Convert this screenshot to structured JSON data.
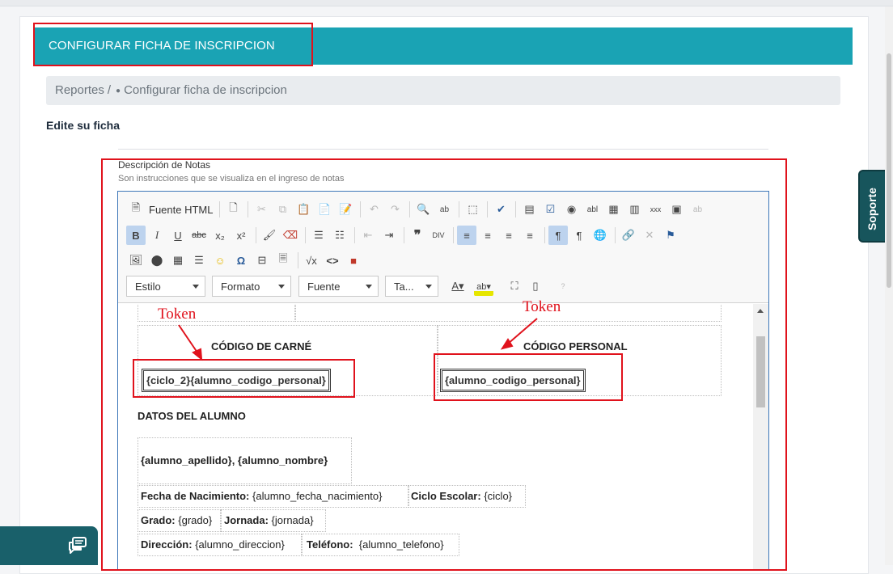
{
  "header": {
    "title": "CONFIGURAR FICHA DE INSCRIPCION"
  },
  "breadcrumb": {
    "root": "Reportes",
    "separator": "/",
    "current": "Configurar ficha de inscripcion"
  },
  "section_title": "Edite su ficha",
  "field": {
    "label": "Descripción de Notas",
    "help": "Son instrucciones que se visualiza en el ingreso de notas"
  },
  "toolbar": {
    "source_label": "Fuente HTML",
    "combos": [
      "Estilo",
      "Formato",
      "Fuente",
      "Ta..."
    ],
    "icons_row1": [
      "source-icon",
      "template-icon",
      "cut-icon",
      "copy-icon",
      "paste-icon",
      "paste-text-icon",
      "paste-word-icon",
      "undo-icon",
      "redo-icon",
      "find-icon",
      "replace-icon",
      "select-all-icon",
      "spellcheck-icon",
      "form-icon",
      "checkbox-icon",
      "radio-icon",
      "textfield-icon",
      "textarea-icon",
      "select-icon",
      "button-icon",
      "image-button-icon",
      "hidden-field-icon"
    ],
    "icons_row2": [
      "bold-icon",
      "italic-icon",
      "underline-icon",
      "strike-icon",
      "subscript-icon",
      "superscript-icon",
      "copy-format-icon",
      "remove-format-icon",
      "numbered-list-icon",
      "bulleted-list-icon",
      "outdent-icon",
      "indent-icon",
      "blockquote-icon",
      "div-icon",
      "align-left-icon",
      "align-center-icon",
      "align-right-icon",
      "justify-icon",
      "ltr-icon",
      "rtl-icon",
      "language-icon",
      "link-icon",
      "unlink-icon",
      "anchor-icon"
    ],
    "icons_row3": [
      "image-icon",
      "flash-icon",
      "table-icon",
      "horizontal-line-icon",
      "smiley-icon",
      "special-char-icon",
      "page-break-icon",
      "iframe-icon",
      "math-icon",
      "code-icon",
      "video-icon"
    ],
    "icons_row4": [
      "text-color-icon",
      "bg-color-icon",
      "maximize-icon",
      "show-blocks-icon",
      "about-icon"
    ]
  },
  "content": {
    "token_label": "Token",
    "carne_heading": "CÓDIGO DE CARNÉ",
    "carne_token": "{ciclo_2}{alumno_codigo_personal}",
    "personal_heading": "CÓDIGO PERSONAL",
    "personal_token": "{alumno_codigo_personal}",
    "datos_heading": "DATOS DEL ALUMNO",
    "nombre_token": "{alumno_apellido}, {alumno_nombre}",
    "fields": [
      {
        "label": "Fecha de Nacimiento:",
        "value": "{alumno_fecha_nacimiento}"
      },
      {
        "label": "Ciclo Escolar:",
        "value": "{ciclo}"
      },
      {
        "label": "Grado:",
        "value": "{grado}"
      },
      {
        "label": "Jornada:",
        "value": "{jornada}"
      },
      {
        "label": "Dirección:",
        "value": "{alumno_direccion}"
      },
      {
        "label": "Teléfono:",
        "value": "{alumno_telefono}"
      }
    ]
  },
  "support_tab": "Soporte",
  "colors": {
    "header": "#1aa3b4",
    "highlight": "#e0121c",
    "support": "#17555c"
  }
}
